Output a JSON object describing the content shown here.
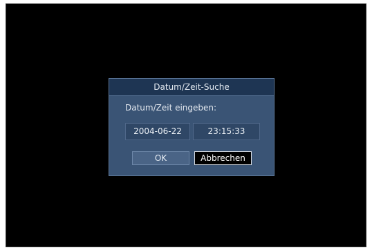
{
  "dialog": {
    "title": "Datum/Zeit-Suche",
    "prompt": "Datum/Zeit eingeben:",
    "date_value": "2004-06-22",
    "time_value": "23:15:33",
    "ok_label": "OK",
    "cancel_label": "Abbrechen"
  },
  "colors": {
    "screen_background": "#000000",
    "dialog_background": "#3a5475",
    "title_bar": "#1e3553",
    "field_background": "#2f4766",
    "focused_button": "#000000"
  }
}
